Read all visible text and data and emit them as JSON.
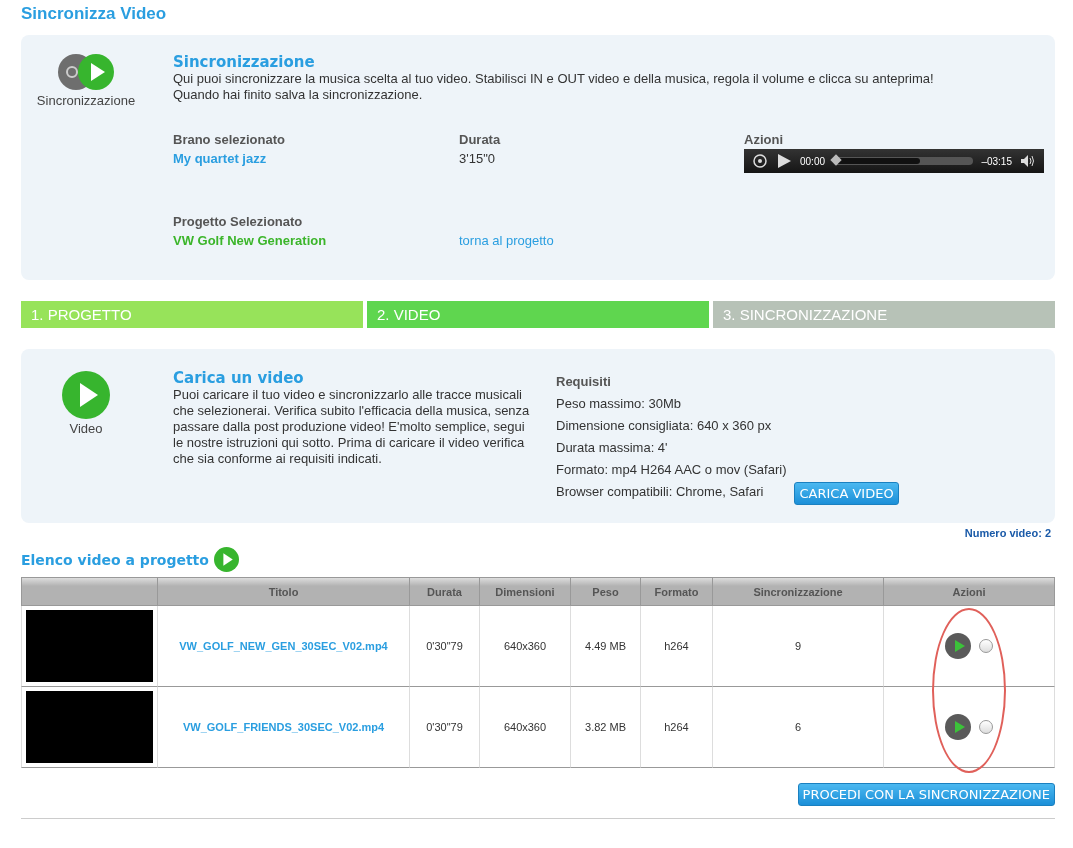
{
  "page_title": "Sincronizza Video",
  "sync_panel": {
    "icon_label": "Sincronizzazione",
    "heading": "Sincronizzazione",
    "description": [
      "Qui puoi sincronizzare la musica scelta al tuo video. Stabilisci IN e OUT video e della musica, regola il volume e clicca su anteprima!",
      "Quando hai finito salva la sincronizzazione."
    ],
    "track": {
      "label": "Brano selezionato",
      "value": "My quartet jazz"
    },
    "duration": {
      "label": "Durata",
      "value": "3'15\"0"
    },
    "actions": {
      "label": "Azioni",
      "player": {
        "current": "00:00",
        "remaining": "–03:15",
        "level": 0
      }
    },
    "project": {
      "label": "Progetto Selezionato",
      "value": "VW Golf New Generation"
    },
    "back_link": "torna al progetto"
  },
  "steps": [
    {
      "label": "1. PROGETTO",
      "completed": true,
      "selected": false
    },
    {
      "label": "2. VIDEO",
      "completed": false,
      "selected": true
    },
    {
      "label": "3. SINCRONIZZAZIONE",
      "completed": false,
      "selected": false
    }
  ],
  "upload_panel": {
    "icon_label": "Video",
    "heading": "Carica un video",
    "description": "Puoi caricare il tuo video e sincronizzarlo alle tracce musicali che selezionerai. Verifica subito l'efficacia della musica, senza passare dalla post produzione video! E'molto semplice, segui le nostre istruzioni qui sotto. Prima di caricare il video verifica che sia conforme ai requisiti indicati.",
    "requirements_title": "Requisiti",
    "requirements": [
      "Peso massimo: 30Mb",
      "Dimensione consigliata: 640 x 360 px",
      "Durata massima: 4'",
      "Formato: mp4 H264 AAC o mov (Safari)",
      "Browser compatibili: Chrome, Safari"
    ],
    "button": "CARICA VIDEO"
  },
  "video_count": "Numero video: 2",
  "list_heading": "Elenco video a progetto",
  "table": {
    "columns": [
      "Titolo",
      "Durata",
      "Dimensioni",
      "Peso",
      "Formato",
      "Sincronizzazione",
      "Azioni"
    ],
    "annotation": {
      "kind": "ellipse"
    },
    "rows": [
      {
        "title": "VW_GOLF_NEW_GEN_30SEC_V02.mp4",
        "duration": "0'30\"79",
        "dimensions": "640x360",
        "size": "4.49 MB",
        "format": "h264",
        "sync": "9",
        "selected": false
      },
      {
        "title": "VW_GOLF_FRIENDS_30SEC_V02.mp4",
        "duration": "0'30\"79",
        "dimensions": "640x360",
        "size": "3.82 MB",
        "format": "h264",
        "sync": "6",
        "selected": false
      }
    ]
  },
  "proceed_button": "PROCEDI CON LA SINCRONIZZAZIONE"
}
